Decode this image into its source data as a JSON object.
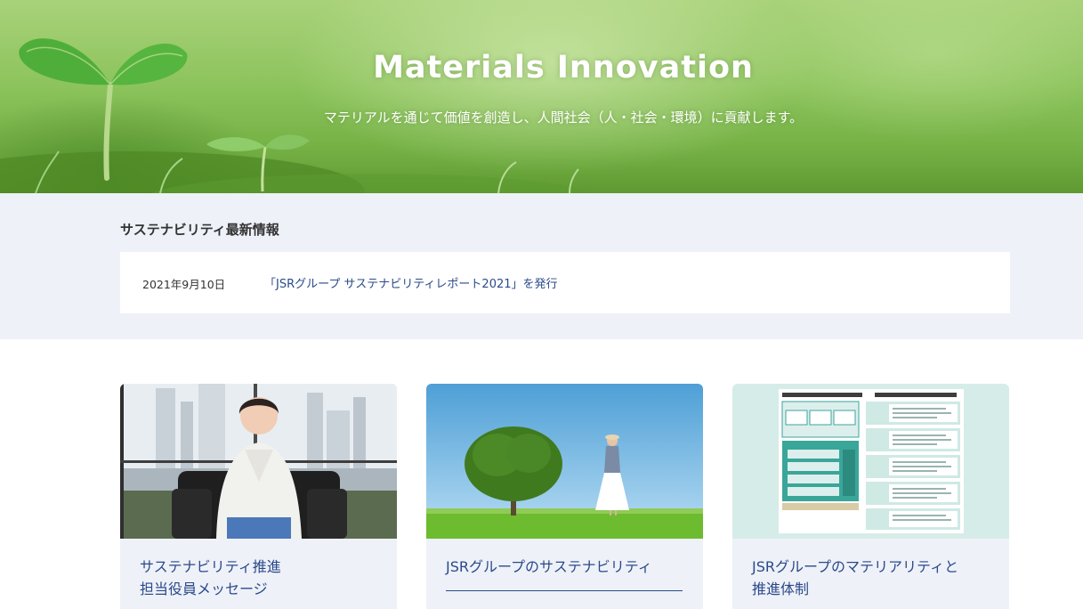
{
  "hero": {
    "title": "Materials Innovation",
    "subtitle": "マテリアルを通じて価値を創造し、人間社会（人・社会・環境）に貢献します。"
  },
  "news": {
    "heading": "サステナビリティ最新情報",
    "items": [
      {
        "date": "2021年9月10日",
        "text": "「JSRグループ サステナビリティレポート2021」を発行"
      }
    ]
  },
  "cards": [
    {
      "title_line1": "サステナビリティ推進",
      "title_line2": "担当役員メッセージ",
      "image": "executive-portrait"
    },
    {
      "title_line1": "JSRグループのサステナビリティ",
      "title_line2": "",
      "image": "tree-field-photo"
    },
    {
      "title_line1": "JSRグループのマテリアリティと",
      "title_line2": "推進体制",
      "image": "materiality-diagram"
    }
  ]
}
